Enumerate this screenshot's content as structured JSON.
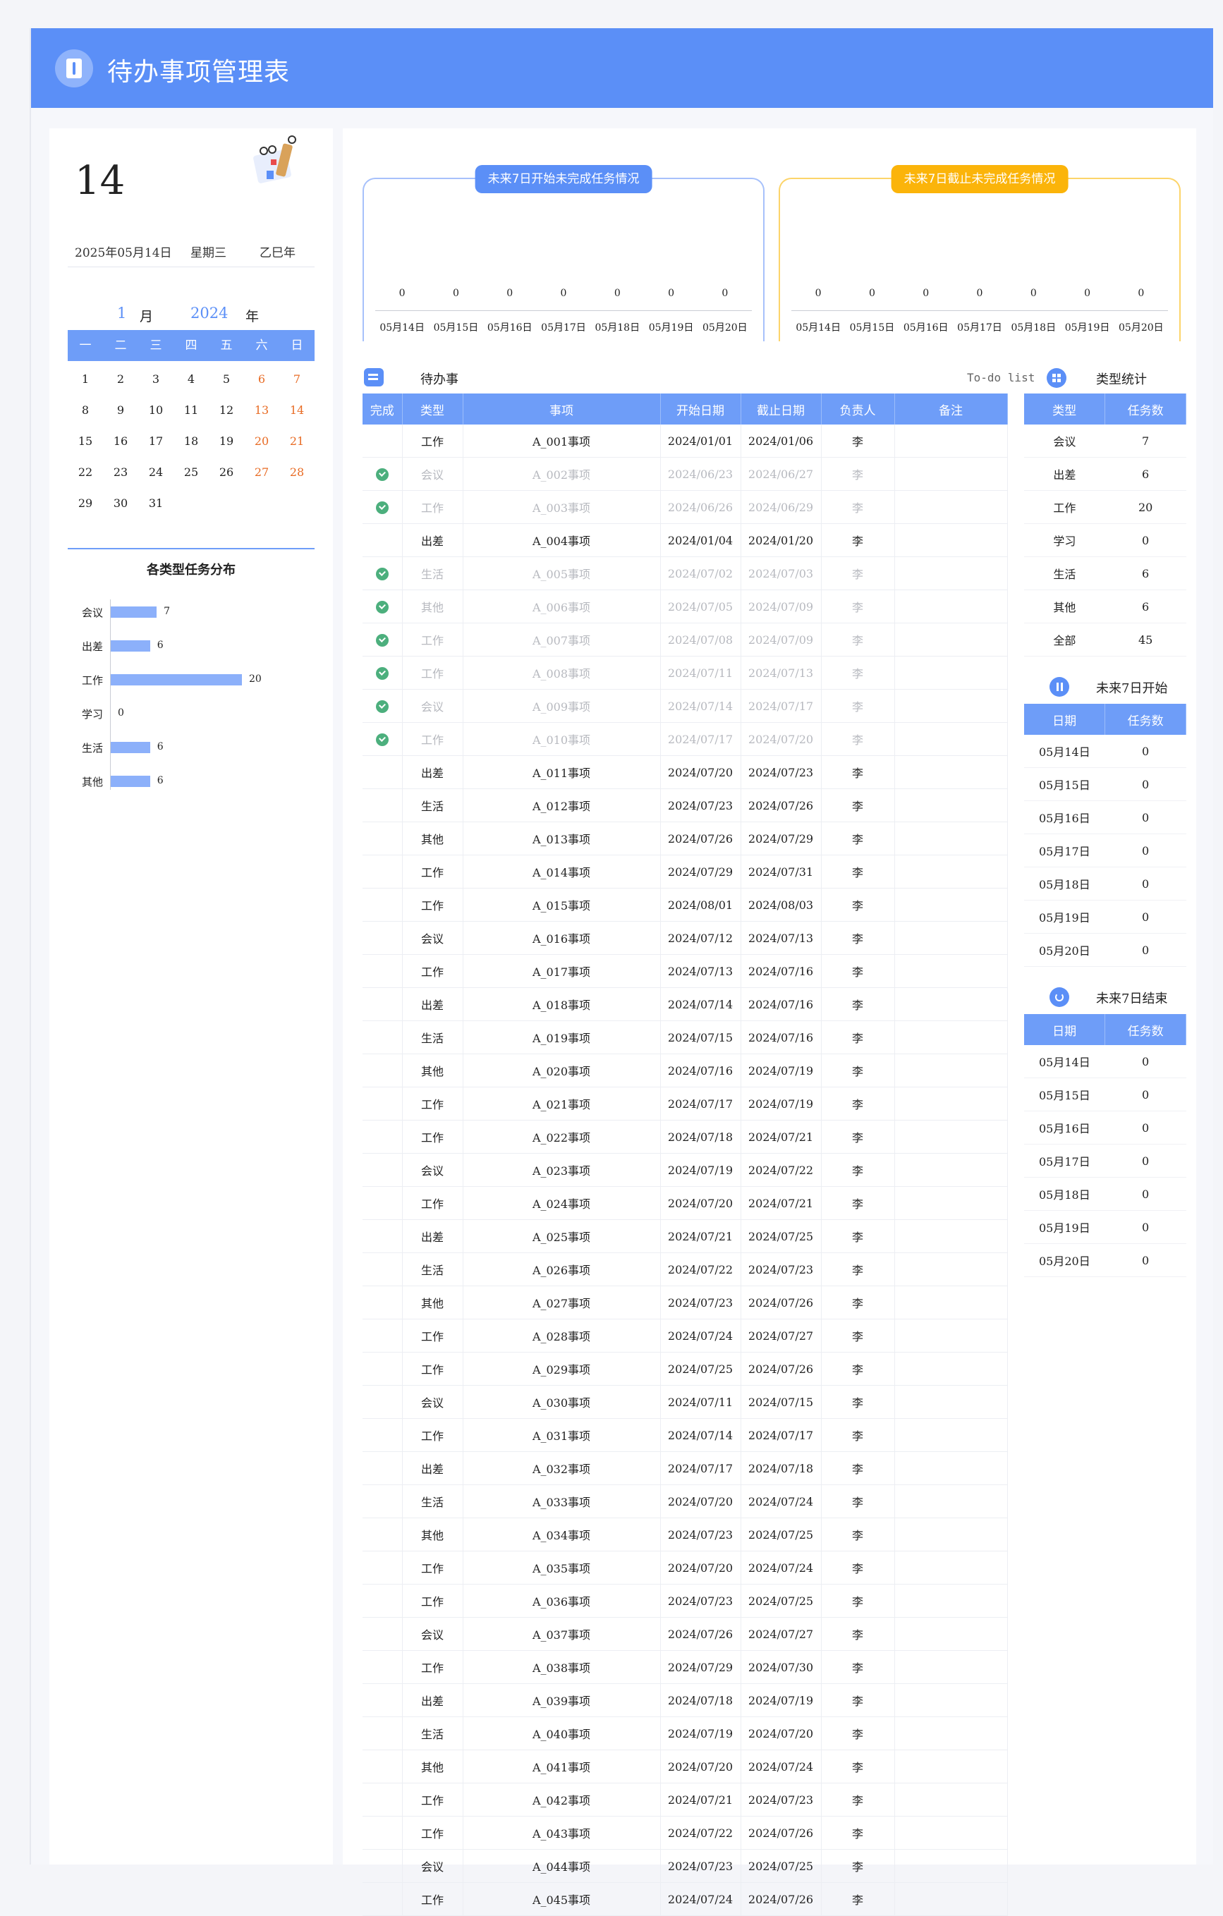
{
  "header": {
    "title": "待办事项管理表",
    "icon": "notebook-icon"
  },
  "calendar": {
    "big_day": "14",
    "date_text": "2025年05月14日",
    "weekday_text": "星期三",
    "lunar_year_text": "乙巳年",
    "month_value": "1",
    "month_label": "月",
    "year_value": "2024",
    "year_label": "年",
    "weekdays": [
      "一",
      "二",
      "三",
      "四",
      "五",
      "六",
      "日"
    ],
    "days": [
      [
        "1",
        "2",
        "3",
        "4",
        "5",
        "6",
        "7"
      ],
      [
        "8",
        "9",
        "10",
        "11",
        "12",
        "13",
        "14"
      ],
      [
        "15",
        "16",
        "17",
        "18",
        "19",
        "20",
        "21"
      ],
      [
        "22",
        "23",
        "24",
        "25",
        "26",
        "27",
        "28"
      ],
      [
        "29",
        "30",
        "31",
        "",
        "",
        "",
        ""
      ]
    ]
  },
  "distribution": {
    "title": "各类型任务分布",
    "chart_data": {
      "type": "bar",
      "orientation": "horizontal",
      "categories": [
        "会议",
        "出差",
        "工作",
        "学习",
        "生活",
        "其他"
      ],
      "values": [
        7,
        6,
        20,
        0,
        6,
        6
      ],
      "xlim": [
        0,
        20
      ]
    }
  },
  "start_chart": {
    "title": "未来7日开始未完成任务情况",
    "chart_data": {
      "type": "bar",
      "categories": [
        "05月14日",
        "05月15日",
        "05月16日",
        "05月17日",
        "05月18日",
        "05月19日",
        "05月20日"
      ],
      "values": [
        0,
        0,
        0,
        0,
        0,
        0,
        0
      ]
    }
  },
  "end_chart": {
    "title": "未来7日截止未完成任务情况",
    "chart_data": {
      "type": "bar",
      "categories": [
        "05月14日",
        "05月15日",
        "05月16日",
        "05月17日",
        "05月18日",
        "05月19日",
        "05月20日"
      ],
      "values": [
        0,
        0,
        0,
        0,
        0,
        0,
        0
      ]
    }
  },
  "todo": {
    "title": "待办事",
    "subtitle": "To-do list",
    "columns": [
      "完成",
      "类型",
      "事项",
      "开始日期",
      "截止日期",
      "负责人",
      "备注"
    ],
    "rows": [
      {
        "done": false,
        "type": "工作",
        "item": "A_001事项",
        "start": "2024/01/01",
        "end": "2024/01/06",
        "owner": "李",
        "note": ""
      },
      {
        "done": true,
        "type": "会议",
        "item": "A_002事项",
        "start": "2024/06/23",
        "end": "2024/06/27",
        "owner": "李",
        "note": ""
      },
      {
        "done": true,
        "type": "工作",
        "item": "A_003事项",
        "start": "2024/06/26",
        "end": "2024/06/29",
        "owner": "李",
        "note": ""
      },
      {
        "done": false,
        "type": "出差",
        "item": "A_004事项",
        "start": "2024/01/04",
        "end": "2024/01/20",
        "owner": "李",
        "note": ""
      },
      {
        "done": true,
        "type": "生活",
        "item": "A_005事项",
        "start": "2024/07/02",
        "end": "2024/07/03",
        "owner": "李",
        "note": ""
      },
      {
        "done": true,
        "type": "其他",
        "item": "A_006事项",
        "start": "2024/07/05",
        "end": "2024/07/09",
        "owner": "李",
        "note": ""
      },
      {
        "done": true,
        "type": "工作",
        "item": "A_007事项",
        "start": "2024/07/08",
        "end": "2024/07/09",
        "owner": "李",
        "note": ""
      },
      {
        "done": true,
        "type": "工作",
        "item": "A_008事项",
        "start": "2024/07/11",
        "end": "2024/07/13",
        "owner": "李",
        "note": ""
      },
      {
        "done": true,
        "type": "会议",
        "item": "A_009事项",
        "start": "2024/07/14",
        "end": "2024/07/17",
        "owner": "李",
        "note": ""
      },
      {
        "done": true,
        "type": "工作",
        "item": "A_010事项",
        "start": "2024/07/17",
        "end": "2024/07/20",
        "owner": "李",
        "note": ""
      },
      {
        "done": false,
        "type": "出差",
        "item": "A_011事项",
        "start": "2024/07/20",
        "end": "2024/07/23",
        "owner": "李",
        "note": ""
      },
      {
        "done": false,
        "type": "生活",
        "item": "A_012事项",
        "start": "2024/07/23",
        "end": "2024/07/26",
        "owner": "李",
        "note": ""
      },
      {
        "done": false,
        "type": "其他",
        "item": "A_013事项",
        "start": "2024/07/26",
        "end": "2024/07/29",
        "owner": "李",
        "note": ""
      },
      {
        "done": false,
        "type": "工作",
        "item": "A_014事项",
        "start": "2024/07/29",
        "end": "2024/07/31",
        "owner": "李",
        "note": ""
      },
      {
        "done": false,
        "type": "工作",
        "item": "A_015事项",
        "start": "2024/08/01",
        "end": "2024/08/03",
        "owner": "李",
        "note": ""
      },
      {
        "done": false,
        "type": "会议",
        "item": "A_016事项",
        "start": "2024/07/12",
        "end": "2024/07/13",
        "owner": "李",
        "note": ""
      },
      {
        "done": false,
        "type": "工作",
        "item": "A_017事项",
        "start": "2024/07/13",
        "end": "2024/07/16",
        "owner": "李",
        "note": ""
      },
      {
        "done": false,
        "type": "出差",
        "item": "A_018事项",
        "start": "2024/07/14",
        "end": "2024/07/16",
        "owner": "李",
        "note": ""
      },
      {
        "done": false,
        "type": "生活",
        "item": "A_019事项",
        "start": "2024/07/15",
        "end": "2024/07/16",
        "owner": "李",
        "note": ""
      },
      {
        "done": false,
        "type": "其他",
        "item": "A_020事项",
        "start": "2024/07/16",
        "end": "2024/07/19",
        "owner": "李",
        "note": ""
      },
      {
        "done": false,
        "type": "工作",
        "item": "A_021事项",
        "start": "2024/07/17",
        "end": "2024/07/19",
        "owner": "李",
        "note": ""
      },
      {
        "done": false,
        "type": "工作",
        "item": "A_022事项",
        "start": "2024/07/18",
        "end": "2024/07/21",
        "owner": "李",
        "note": ""
      },
      {
        "done": false,
        "type": "会议",
        "item": "A_023事项",
        "start": "2024/07/19",
        "end": "2024/07/22",
        "owner": "李",
        "note": ""
      },
      {
        "done": false,
        "type": "工作",
        "item": "A_024事项",
        "start": "2024/07/20",
        "end": "2024/07/21",
        "owner": "李",
        "note": ""
      },
      {
        "done": false,
        "type": "出差",
        "item": "A_025事项",
        "start": "2024/07/21",
        "end": "2024/07/25",
        "owner": "李",
        "note": ""
      },
      {
        "done": false,
        "type": "生活",
        "item": "A_026事项",
        "start": "2024/07/22",
        "end": "2024/07/23",
        "owner": "李",
        "note": ""
      },
      {
        "done": false,
        "type": "其他",
        "item": "A_027事项",
        "start": "2024/07/23",
        "end": "2024/07/26",
        "owner": "李",
        "note": ""
      },
      {
        "done": false,
        "type": "工作",
        "item": "A_028事项",
        "start": "2024/07/24",
        "end": "2024/07/27",
        "owner": "李",
        "note": ""
      },
      {
        "done": false,
        "type": "工作",
        "item": "A_029事项",
        "start": "2024/07/25",
        "end": "2024/07/26",
        "owner": "李",
        "note": ""
      },
      {
        "done": false,
        "type": "会议",
        "item": "A_030事项",
        "start": "2024/07/11",
        "end": "2024/07/15",
        "owner": "李",
        "note": ""
      },
      {
        "done": false,
        "type": "工作",
        "item": "A_031事项",
        "start": "2024/07/14",
        "end": "2024/07/17",
        "owner": "李",
        "note": ""
      },
      {
        "done": false,
        "type": "出差",
        "item": "A_032事项",
        "start": "2024/07/17",
        "end": "2024/07/18",
        "owner": "李",
        "note": ""
      },
      {
        "done": false,
        "type": "生活",
        "item": "A_033事项",
        "start": "2024/07/20",
        "end": "2024/07/24",
        "owner": "李",
        "note": ""
      },
      {
        "done": false,
        "type": "其他",
        "item": "A_034事项",
        "start": "2024/07/23",
        "end": "2024/07/25",
        "owner": "李",
        "note": ""
      },
      {
        "done": false,
        "type": "工作",
        "item": "A_035事项",
        "start": "2024/07/20",
        "end": "2024/07/24",
        "owner": "李",
        "note": ""
      },
      {
        "done": false,
        "type": "工作",
        "item": "A_036事项",
        "start": "2024/07/23",
        "end": "2024/07/25",
        "owner": "李",
        "note": ""
      },
      {
        "done": false,
        "type": "会议",
        "item": "A_037事项",
        "start": "2024/07/26",
        "end": "2024/07/27",
        "owner": "李",
        "note": ""
      },
      {
        "done": false,
        "type": "工作",
        "item": "A_038事项",
        "start": "2024/07/29",
        "end": "2024/07/30",
        "owner": "李",
        "note": ""
      },
      {
        "done": false,
        "type": "出差",
        "item": "A_039事项",
        "start": "2024/07/18",
        "end": "2024/07/19",
        "owner": "李",
        "note": ""
      },
      {
        "done": false,
        "type": "生活",
        "item": "A_040事项",
        "start": "2024/07/19",
        "end": "2024/07/20",
        "owner": "李",
        "note": ""
      },
      {
        "done": false,
        "type": "其他",
        "item": "A_041事项",
        "start": "2024/07/20",
        "end": "2024/07/24",
        "owner": "李",
        "note": ""
      },
      {
        "done": false,
        "type": "工作",
        "item": "A_042事项",
        "start": "2024/07/21",
        "end": "2024/07/23",
        "owner": "李",
        "note": ""
      },
      {
        "done": false,
        "type": "工作",
        "item": "A_043事项",
        "start": "2024/07/22",
        "end": "2024/07/26",
        "owner": "李",
        "note": ""
      },
      {
        "done": false,
        "type": "会议",
        "item": "A_044事项",
        "start": "2024/07/23",
        "end": "2024/07/25",
        "owner": "李",
        "note": ""
      },
      {
        "done": false,
        "type": "工作",
        "item": "A_045事项",
        "start": "2024/07/24",
        "end": "2024/07/26",
        "owner": "李",
        "note": ""
      }
    ]
  },
  "type_stats": {
    "title": "类型统计",
    "columns": [
      "类型",
      "任务数"
    ],
    "rows": [
      [
        "会议",
        "7"
      ],
      [
        "出差",
        "6"
      ],
      [
        "工作",
        "20"
      ],
      [
        "学习",
        "0"
      ],
      [
        "生活",
        "6"
      ],
      [
        "其他",
        "6"
      ],
      [
        "全部",
        "45"
      ]
    ]
  },
  "start7": {
    "title": "未来7日开始",
    "columns": [
      "日期",
      "任务数"
    ],
    "rows": [
      [
        "05月14日",
        "0"
      ],
      [
        "05月15日",
        "0"
      ],
      [
        "05月16日",
        "0"
      ],
      [
        "05月17日",
        "0"
      ],
      [
        "05月18日",
        "0"
      ],
      [
        "05月19日",
        "0"
      ],
      [
        "05月20日",
        "0"
      ]
    ]
  },
  "end7": {
    "title": "未来7日结束",
    "columns": [
      "日期",
      "任务数"
    ],
    "rows": [
      [
        "05月14日",
        "0"
      ],
      [
        "05月15日",
        "0"
      ],
      [
        "05月16日",
        "0"
      ],
      [
        "05月17日",
        "0"
      ],
      [
        "05月18日",
        "0"
      ],
      [
        "05月19日",
        "0"
      ],
      [
        "05月20日",
        "0"
      ]
    ]
  },
  "colors": {
    "primary": "#5b8ff7",
    "header": "#6e9df8",
    "accent_yellow": "#fbb40a",
    "weekend": "#e86b24",
    "done_check": "#4caf7d"
  }
}
